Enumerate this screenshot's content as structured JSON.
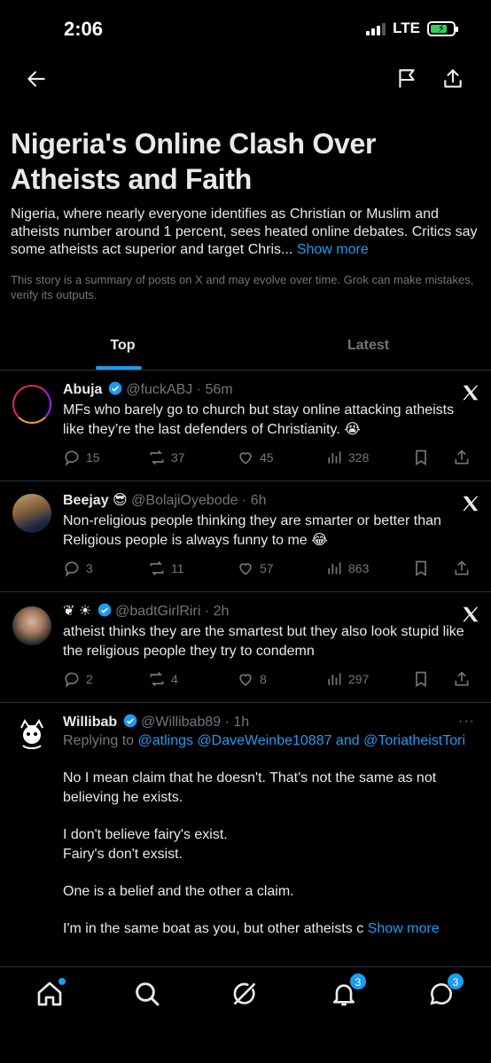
{
  "status_bar": {
    "time": "2:06",
    "network": "LTE"
  },
  "story": {
    "title": "Nigeria's Online Clash Over Atheists and Faith",
    "summary": "Nigeria, where nearly everyone identifies as Christian or Muslim and atheists number around 1 percent, sees heated online debates. Critics say some atheists act superior and target Chris... ",
    "show_more": "Show more",
    "disclaimer": "This story is a summary of posts on X and may evolve over time. Grok can make mistakes, verify its outputs."
  },
  "tabs": [
    {
      "label": "Top",
      "active": true
    },
    {
      "label": "Latest",
      "active": false
    }
  ],
  "posts": [
    {
      "name": "Abuja",
      "handle": "@fuckABJ",
      "time": "56m",
      "text": "MFs who barely go to church but stay online attacking atheists like they’re the last defenders of Christianity. 😭",
      "replies": "15",
      "reposts": "37",
      "likes": "45",
      "views": "328"
    },
    {
      "name": "Beejay 😎",
      "handle": "@BolajiOyebode",
      "time": "6h",
      "text": "Non-religious people thinking they are smarter or better than Religious people is always funny to me 😂",
      "replies": "3",
      "reposts": "11",
      "likes": "57",
      "views": "863"
    },
    {
      "name": "❦ ☀︎",
      "handle": "@badtGirlRiri",
      "time": "2h",
      "text": "atheist thinks they are the smartest but they also look stupid like the religious people they try to condemn",
      "replies": "2",
      "reposts": "4",
      "likes": "8",
      "views": "297"
    },
    {
      "name": "Willibab",
      "handle": "@Willibab89",
      "time": "1h",
      "replying_label": "Replying to",
      "mentions": "@atlings @DaveWeinbe10887 and @ToriatheistTori",
      "para1": "No I mean claim that he doesn't. That's not the same as not believing he exists.",
      "para2a": "I don't believe fairy's exist.",
      "para2b": "Fairy's don't exsist.",
      "para3": "One is a belief and the other a claim.",
      "para4": "I'm in the same boat as you, but other atheists c ",
      "show_more": "Show more",
      "more": "···"
    }
  ],
  "bottom_nav": {
    "notifications_badge": "3",
    "messages_badge": "3"
  },
  "colors": {
    "accent": "#1d9bf0",
    "muted": "#71767b",
    "background": "#000000"
  }
}
